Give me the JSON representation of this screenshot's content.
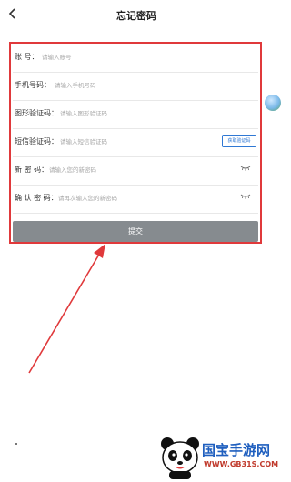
{
  "header": {
    "title": "忘记密码",
    "back_icon": "chevron-left-icon"
  },
  "form": {
    "account": {
      "label": "账 号：",
      "placeholder": "请输入账号"
    },
    "phone": {
      "label": "手机号码：",
      "placeholder": "请输入手机号码"
    },
    "image_code": {
      "label": "图形验证码：",
      "placeholder": "请输入图形验证码"
    },
    "sms_code": {
      "label": "短信验证码：",
      "placeholder": "请输入短信验证码",
      "button": "获取验证码"
    },
    "new_password": {
      "label": "新 密 码：",
      "placeholder": "请输入您的新密码",
      "icon": "eye-closed-icon"
    },
    "confirm_password": {
      "label": "确 认 密 码：",
      "placeholder": "请再次输入您的新密码",
      "icon": "eye-closed-icon"
    },
    "submit": "提交"
  },
  "colors": {
    "highlight": "#e0393b",
    "button_bg": "#868b8f",
    "link_blue": "#2f78d4"
  },
  "watermark": {
    "brand": "国宝手游网",
    "url": "WWW.GB31S.COM"
  }
}
